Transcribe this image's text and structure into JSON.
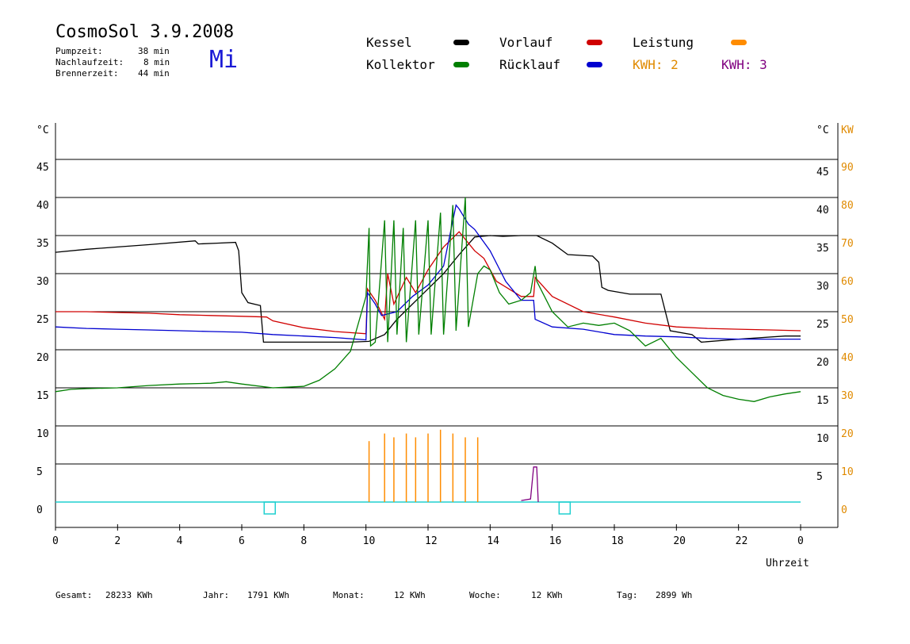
{
  "header": {
    "title": "CosmoSol 3.9.2008",
    "day": "Mi",
    "stats": [
      {
        "label": "Pumpzeit:",
        "value": "38 min"
      },
      {
        "label": "Nachlaufzeit:",
        "value": "8 min"
      },
      {
        "label": "Brennerzeit:",
        "value": "44 min"
      }
    ]
  },
  "legend": {
    "kessel": {
      "label": "Kessel",
      "color": "#000000"
    },
    "kollektor": {
      "label": "Kollektor",
      "color": "#007f00"
    },
    "vorlauf": {
      "label": "Vorlauf",
      "color": "#d00000"
    },
    "ruecklauf": {
      "label": "Rücklauf",
      "color": "#0000d0"
    },
    "leistung": {
      "label": "Leistung",
      "color": "#ff8c00"
    },
    "kwh2": {
      "label": "KWH: 2",
      "color": "#e08a00"
    },
    "kwh3": {
      "label": "KWH: 3",
      "color": "#800080"
    }
  },
  "footer": {
    "gesamt": {
      "label": "Gesamt:",
      "value": "28233 KWh"
    },
    "jahr": {
      "label": "Jahr:",
      "value": "1791 KWh"
    },
    "monat": {
      "label": "Monat:",
      "value": "12 KWh"
    },
    "woche": {
      "label": "Woche:",
      "value": "12 KWh"
    },
    "tag": {
      "label": "Tag:",
      "value": "2899 Wh"
    }
  },
  "chart_data": {
    "type": "line",
    "xlabel": "Uhrzeit",
    "ylabel_left": "°C",
    "ylabel_right": "°C",
    "ylabel_right2": "KW",
    "x_ticks": [
      "0",
      "2",
      "4",
      "6",
      "8",
      "10",
      "12",
      "14",
      "16",
      "18",
      "20",
      "22",
      "0"
    ],
    "y_ticks_left": [
      "0",
      "5",
      "10",
      "15",
      "20",
      "25",
      "30",
      "35",
      "40",
      "45"
    ],
    "y_ticks_right": [
      "5",
      "10",
      "15",
      "20",
      "25",
      "30",
      "35",
      "40",
      "45"
    ],
    "y_ticks_kw": [
      "0",
      "10",
      "20",
      "30",
      "40",
      "50",
      "60",
      "70",
      "80",
      "90"
    ],
    "xlim": [
      0,
      24
    ],
    "ylim": [
      0,
      50
    ],
    "grid": true,
    "series": [
      {
        "name": "Kessel",
        "color": "#000000",
        "points": [
          [
            0,
            32.8
          ],
          [
            1,
            33.2
          ],
          [
            2,
            33.5
          ],
          [
            3,
            33.8
          ],
          [
            4.5,
            34.3
          ],
          [
            4.6,
            33.9
          ],
          [
            5.2,
            34.0
          ],
          [
            5.8,
            34.1
          ],
          [
            5.9,
            33.0
          ],
          [
            6.0,
            27.5
          ],
          [
            6.2,
            26.2
          ],
          [
            6.5,
            25.9
          ],
          [
            6.6,
            25.8
          ],
          [
            6.7,
            21.0
          ],
          [
            8,
            21.0
          ],
          [
            9.5,
            21.0
          ],
          [
            10.1,
            21.1
          ],
          [
            10.6,
            22.0
          ],
          [
            11,
            24.0
          ],
          [
            11.5,
            26.0
          ],
          [
            12,
            28.0
          ],
          [
            12.5,
            30.0
          ],
          [
            13,
            32.5
          ],
          [
            13.5,
            34.8
          ],
          [
            14,
            35.0
          ],
          [
            14.4,
            34.9
          ],
          [
            15,
            35.0
          ],
          [
            15.5,
            35.0
          ],
          [
            16,
            34.0
          ],
          [
            16.5,
            32.5
          ],
          [
            17.3,
            32.3
          ],
          [
            17.5,
            31.5
          ],
          [
            17.6,
            28.2
          ],
          [
            17.8,
            27.8
          ],
          [
            18.5,
            27.3
          ],
          [
            19.5,
            27.3
          ],
          [
            19.8,
            22.5
          ],
          [
            20.5,
            22.0
          ],
          [
            20.8,
            21.0
          ],
          [
            22,
            21.4
          ],
          [
            23.5,
            21.8
          ],
          [
            24,
            21.8
          ]
        ]
      },
      {
        "name": "Vorlauf",
        "color": "#d00000",
        "points": [
          [
            0,
            25.0
          ],
          [
            1,
            25.0
          ],
          [
            2,
            24.9
          ],
          [
            3,
            24.8
          ],
          [
            4,
            24.6
          ],
          [
            5,
            24.5
          ],
          [
            6,
            24.4
          ],
          [
            6.8,
            24.3
          ],
          [
            7,
            23.8
          ],
          [
            8,
            22.9
          ],
          [
            9,
            22.4
          ],
          [
            10,
            22.1
          ],
          [
            10.05,
            28.0
          ],
          [
            10.3,
            26.5
          ],
          [
            10.6,
            24.0
          ],
          [
            10.7,
            30.0
          ],
          [
            10.9,
            26.0
          ],
          [
            11.3,
            29.5
          ],
          [
            11.6,
            27.5
          ],
          [
            12.0,
            30.5
          ],
          [
            12.5,
            33.5
          ],
          [
            13.0,
            35.5
          ],
          [
            13.5,
            33.0
          ],
          [
            13.8,
            32.0
          ],
          [
            14.2,
            29.0
          ],
          [
            15.0,
            27.0
          ],
          [
            15.4,
            27.0
          ],
          [
            15.45,
            29.5
          ],
          [
            16,
            27.0
          ],
          [
            17,
            25.0
          ],
          [
            18,
            24.3
          ],
          [
            19,
            23.5
          ],
          [
            20,
            23.0
          ],
          [
            21,
            22.8
          ],
          [
            22,
            22.7
          ],
          [
            23,
            22.6
          ],
          [
            24,
            22.5
          ]
        ]
      },
      {
        "name": "Rücklauf",
        "color": "#0000d0",
        "points": [
          [
            0,
            23.0
          ],
          [
            1,
            22.8
          ],
          [
            2,
            22.7
          ],
          [
            3,
            22.6
          ],
          [
            4,
            22.5
          ],
          [
            5,
            22.4
          ],
          [
            6,
            22.3
          ],
          [
            7,
            22.0
          ],
          [
            8,
            21.8
          ],
          [
            9,
            21.6
          ],
          [
            10,
            21.3
          ],
          [
            10.05,
            27.5
          ],
          [
            10.3,
            26.0
          ],
          [
            10.5,
            24.5
          ],
          [
            11,
            25.0
          ],
          [
            11.5,
            27.0
          ],
          [
            12,
            28.5
          ],
          [
            12.5,
            31.0
          ],
          [
            12.9,
            39.0
          ],
          [
            13.0,
            38.5
          ],
          [
            13.3,
            36.5
          ],
          [
            13.5,
            35.8
          ],
          [
            14,
            33.0
          ],
          [
            14.5,
            29.0
          ],
          [
            15,
            26.5
          ],
          [
            15.4,
            26.5
          ],
          [
            15.45,
            24.0
          ],
          [
            16,
            23.0
          ],
          [
            17,
            22.7
          ],
          [
            18,
            22.0
          ],
          [
            19,
            21.8
          ],
          [
            20,
            21.7
          ],
          [
            21,
            21.5
          ],
          [
            22,
            21.4
          ],
          [
            23,
            21.4
          ],
          [
            24,
            21.4
          ]
        ]
      },
      {
        "name": "Kollektor",
        "color": "#007f00",
        "points": [
          [
            0,
            14.5
          ],
          [
            0.5,
            14.8
          ],
          [
            1,
            14.9
          ],
          [
            2,
            15.0
          ],
          [
            3,
            15.3
          ],
          [
            4,
            15.5
          ],
          [
            5,
            15.6
          ],
          [
            5.5,
            15.8
          ],
          [
            6,
            15.5
          ],
          [
            7,
            15.0
          ],
          [
            8,
            15.2
          ],
          [
            8.5,
            16.0
          ],
          [
            9,
            17.5
          ],
          [
            9.5,
            19.8
          ],
          [
            10,
            27.0
          ],
          [
            10.1,
            36.0
          ],
          [
            10.15,
            20.5
          ],
          [
            10.3,
            21.0
          ],
          [
            10.6,
            37.0
          ],
          [
            10.7,
            21.0
          ],
          [
            10.9,
            37.0
          ],
          [
            11.0,
            22.0
          ],
          [
            11.2,
            36.0
          ],
          [
            11.3,
            21.0
          ],
          [
            11.6,
            37.0
          ],
          [
            11.7,
            22.0
          ],
          [
            12.0,
            37.0
          ],
          [
            12.1,
            22.0
          ],
          [
            12.4,
            38.0
          ],
          [
            12.5,
            22.0
          ],
          [
            12.8,
            39.0
          ],
          [
            12.9,
            22.5
          ],
          [
            13.2,
            40.0
          ],
          [
            13.3,
            23.0
          ],
          [
            13.6,
            30.0
          ],
          [
            13.8,
            31.0
          ],
          [
            14.0,
            30.5
          ],
          [
            14.3,
            27.5
          ],
          [
            14.6,
            26.0
          ],
          [
            15.0,
            26.5
          ],
          [
            15.3,
            27.5
          ],
          [
            15.45,
            31.0
          ],
          [
            15.5,
            29.0
          ],
          [
            16.0,
            25.0
          ],
          [
            16.5,
            23.0
          ],
          [
            17.0,
            23.5
          ],
          [
            17.5,
            23.2
          ],
          [
            18.0,
            23.5
          ],
          [
            18.5,
            22.5
          ],
          [
            19.0,
            20.5
          ],
          [
            19.5,
            21.5
          ],
          [
            20.0,
            19.0
          ],
          [
            20.5,
            17.0
          ],
          [
            21.0,
            15.0
          ],
          [
            21.5,
            14.0
          ],
          [
            22.0,
            13.5
          ],
          [
            22.5,
            13.2
          ],
          [
            23.0,
            13.8
          ],
          [
            23.5,
            14.2
          ],
          [
            24,
            14.5
          ]
        ]
      },
      {
        "name": "Leistung",
        "color": "#ff8c00",
        "peaks": [
          10.1,
          10.6,
          10.9,
          11.3,
          11.6,
          12.0,
          12.4,
          12.8,
          13.2,
          13.6
        ],
        "peak_values": [
          8.0,
          9.0,
          8.5,
          9.0,
          8.5,
          9.0,
          9.5,
          9.0,
          8.5,
          8.5
        ]
      },
      {
        "name": "KWH: 3",
        "color": "#800080",
        "points": [
          [
            15.0,
            0.2
          ],
          [
            15.3,
            0.4
          ],
          [
            15.4,
            4.6
          ],
          [
            15.5,
            4.6
          ],
          [
            15.55,
            0.0
          ]
        ]
      }
    ],
    "pump_markers": [
      6.9,
      16.4
    ]
  }
}
